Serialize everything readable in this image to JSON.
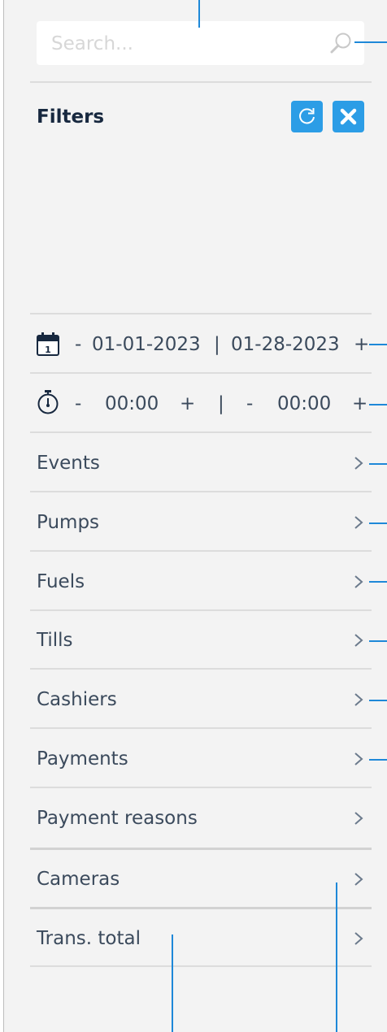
{
  "search": {
    "placeholder": "Search..."
  },
  "filters": {
    "title": "Filters"
  },
  "date_range": {
    "decrement": "-",
    "start": "01-01-2023",
    "separator": "|",
    "end": "01-28-2023",
    "increment": "+"
  },
  "time_range": {
    "start_decrement": "-",
    "start": "00:00",
    "start_increment": "+",
    "separator": "|",
    "end_decrement": "-",
    "end": "00:00",
    "end_increment": "+"
  },
  "filter_items": [
    {
      "label": "Events"
    },
    {
      "label": "Pumps"
    },
    {
      "label": "Fuels"
    },
    {
      "label": "Tills"
    },
    {
      "label": "Cashiers"
    },
    {
      "label": "Payments"
    },
    {
      "label": "Payment reasons"
    },
    {
      "label": "Cameras"
    },
    {
      "label": "Trans. total"
    }
  ],
  "colors": {
    "accent": "#2C9DE6",
    "callout": "#1E88D8",
    "title": "#17283F",
    "text": "#3B4A5C",
    "panel_bg": "#F3F3F3"
  },
  "icons": [
    "search-icon",
    "refresh-icon",
    "close-icon",
    "calendar-icon",
    "stopwatch-icon",
    "chevron-right-icon"
  ]
}
